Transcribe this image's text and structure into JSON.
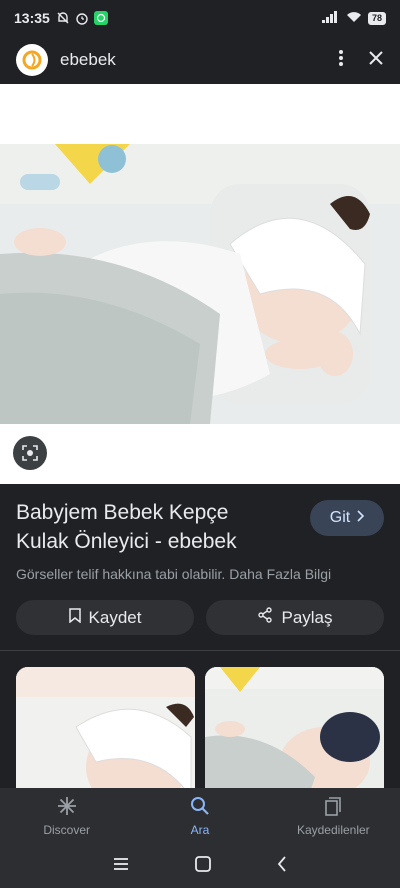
{
  "status": {
    "time": "13:35",
    "battery": "78"
  },
  "header": {
    "site_name": "ebebek"
  },
  "result": {
    "title": "Babyjem Bebek Kepçe Kulak Önleyici - ebebek",
    "visit_label": "Git",
    "copyright_text": "Görseller telif hakkına tabi olabilir. Daha Fazla Bilgi",
    "save_label": "Kaydet",
    "share_label": "Paylaş"
  },
  "bottom_nav": {
    "items": [
      {
        "label": "Discover",
        "icon": "asterisk-icon"
      },
      {
        "label": "Ara",
        "icon": "search-icon"
      },
      {
        "label": "Kaydedilenler",
        "icon": "saved-icon"
      }
    ]
  },
  "colors": {
    "accent": "#8ab4f8",
    "background": "#202124",
    "logo_orange": "#f5a623"
  }
}
